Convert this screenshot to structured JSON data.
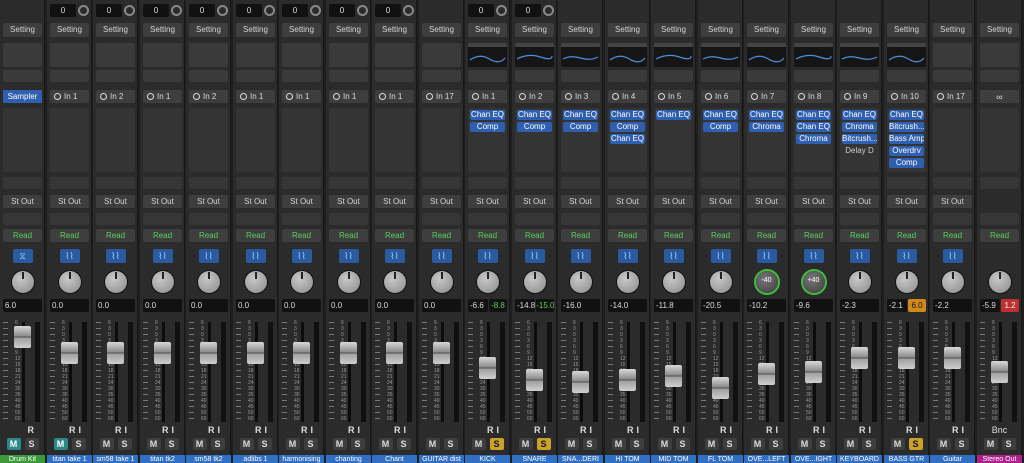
{
  "setting_label": "Setting",
  "read_label": "Read",
  "strips": [
    {
      "gain": "",
      "eq": "empty",
      "input_type": "sampler",
      "input": "Sampler",
      "plugins": [],
      "output": "St Out",
      "pan": "",
      "pan_kind": "io",
      "volume": "6.0",
      "peak": "",
      "peak_style": "none",
      "fader": 0.95,
      "ri": "R",
      "mute_on": true,
      "solo_on": false,
      "name": "Drum Kit",
      "name_color": "#3a9a3a",
      "wave_color": "none"
    },
    {
      "gain": "0",
      "eq": "empty",
      "input_type": "input",
      "input": "In 1",
      "plugins": [],
      "output": "St Out",
      "pan": "",
      "pan_kind": "knob",
      "volume": "0.0",
      "peak": "",
      "peak_style": "none",
      "fader": 0.75,
      "ri": "RI",
      "mute_on": true,
      "solo_on": false,
      "name": "titan take 1",
      "name_color": "#2f6fc4",
      "wave_color": "wave"
    },
    {
      "gain": "0",
      "eq": "empty",
      "input_type": "input",
      "input": "In 2",
      "plugins": [],
      "output": "St Out",
      "pan": "",
      "pan_kind": "knob",
      "volume": "0.0",
      "peak": "",
      "peak_style": "none",
      "fader": 0.75,
      "ri": "RI",
      "mute_on": false,
      "solo_on": false,
      "name": "sm58 take 1",
      "name_color": "#2f6fc4",
      "wave_color": "wave"
    },
    {
      "gain": "0",
      "eq": "empty",
      "input_type": "input",
      "input": "In 1",
      "plugins": [],
      "output": "St Out",
      "pan": "",
      "pan_kind": "knob",
      "volume": "0.0",
      "peak": "",
      "peak_style": "none",
      "fader": 0.75,
      "ri": "RI",
      "mute_on": false,
      "solo_on": false,
      "name": "titan tk2",
      "name_color": "#2f6fc4",
      "wave_color": "wave"
    },
    {
      "gain": "0",
      "eq": "empty",
      "input_type": "input",
      "input": "In 2",
      "plugins": [],
      "output": "St Out",
      "pan": "",
      "pan_kind": "knob",
      "volume": "0.0",
      "peak": "",
      "peak_style": "none",
      "fader": 0.75,
      "ri": "RI",
      "mute_on": false,
      "solo_on": false,
      "name": "sm58 tk2",
      "name_color": "#2f6fc4",
      "wave_color": "wave"
    },
    {
      "gain": "0",
      "eq": "empty",
      "input_type": "input",
      "input": "In 1",
      "plugins": [],
      "output": "St Out",
      "pan": "",
      "pan_kind": "knob",
      "volume": "0.0",
      "peak": "",
      "peak_style": "none",
      "fader": 0.75,
      "ri": "RI",
      "mute_on": false,
      "solo_on": false,
      "name": "adlibs 1",
      "name_color": "#2f6fc4",
      "wave_color": "wave"
    },
    {
      "gain": "0",
      "eq": "empty",
      "input_type": "input",
      "input": "In 1",
      "plugins": [],
      "output": "St Out",
      "pan": "",
      "pan_kind": "knob",
      "volume": "0.0",
      "peak": "",
      "peak_style": "none",
      "fader": 0.75,
      "ri": "RI",
      "mute_on": false,
      "solo_on": false,
      "name": "harmonising",
      "name_color": "#2f6fc4",
      "wave_color": "wave"
    },
    {
      "gain": "0",
      "eq": "empty",
      "input_type": "input",
      "input": "In 1",
      "plugins": [],
      "output": "St Out",
      "pan": "",
      "pan_kind": "knob",
      "volume": "0.0",
      "peak": "",
      "peak_style": "none",
      "fader": 0.75,
      "ri": "RI",
      "mute_on": false,
      "solo_on": false,
      "name": "chanting",
      "name_color": "#2f6fc4",
      "wave_color": "wave"
    },
    {
      "gain": "0",
      "eq": "empty",
      "input_type": "input",
      "input": "In 1",
      "plugins": [],
      "output": "St Out",
      "pan": "",
      "pan_kind": "knob",
      "volume": "0.0",
      "peak": "",
      "peak_style": "none",
      "fader": 0.75,
      "ri": "RI",
      "mute_on": false,
      "solo_on": false,
      "name": "Chant",
      "name_color": "#2f6fc4",
      "wave_color": "wave"
    },
    {
      "gain": "",
      "eq": "empty",
      "input_type": "input",
      "input": "In 17",
      "plugins": [],
      "output": "St Out",
      "pan": "",
      "pan_kind": "knob",
      "volume": "0.0",
      "peak": "",
      "peak_style": "none",
      "fader": 0.75,
      "ri": "",
      "mute_on": false,
      "solo_on": false,
      "name": "GUITAR dist",
      "name_color": "#2f6fc4",
      "wave_color": "wave"
    },
    {
      "gain": "0",
      "eq": "curve",
      "input_type": "input",
      "input": "In 1",
      "plugins": [
        "Chan EQ",
        "Comp"
      ],
      "output": "St Out",
      "pan": "",
      "pan_kind": "knob",
      "volume": "-6.6",
      "peak": "-8.8",
      "peak_style": "green",
      "fader": 0.55,
      "ri": "RI",
      "mute_on": false,
      "solo_on": true,
      "name": "KICK",
      "name_color": "#2f6fc4",
      "wave_color": "wave"
    },
    {
      "gain": "0",
      "eq": "curve",
      "input_type": "input",
      "input": "In 2",
      "plugins": [
        "Chan EQ",
        "Comp"
      ],
      "output": "St Out",
      "pan": "",
      "pan_kind": "knob",
      "volume": "-14.8",
      "peak": "-15.0",
      "peak_style": "green",
      "fader": 0.4,
      "ri": "RI",
      "mute_on": false,
      "solo_on": true,
      "name": "SNARE",
      "name_color": "#2f6fc4",
      "wave_color": "wave"
    },
    {
      "gain": "",
      "eq": "curve",
      "input_type": "input",
      "input": "In 3",
      "plugins": [
        "Chan EQ",
        "Comp"
      ],
      "output": "St Out",
      "pan": "",
      "pan_kind": "knob",
      "volume": "-16.0",
      "peak": "",
      "peak_style": "none",
      "fader": 0.37,
      "ri": "RI",
      "mute_on": false,
      "solo_on": false,
      "name": "SNA...DERI",
      "name_color": "#2f6fc4",
      "wave_color": "wave"
    },
    {
      "gain": "",
      "eq": "curve",
      "input_type": "input",
      "input": "In 4",
      "plugins": [
        "Chan EQ",
        "Comp",
        "Chan EQ"
      ],
      "output": "St Out",
      "pan": "",
      "pan_kind": "knob",
      "volume": "-14.0",
      "peak": "",
      "peak_style": "none",
      "fader": 0.4,
      "ri": "RI",
      "mute_on": false,
      "solo_on": false,
      "name": "HI TOM",
      "name_color": "#2f6fc4",
      "wave_color": "wave"
    },
    {
      "gain": "",
      "eq": "curve",
      "input_type": "input",
      "input": "In 5",
      "plugins": [
        "Chan EQ"
      ],
      "output": "St Out",
      "pan": "",
      "pan_kind": "knob",
      "volume": "-11.8",
      "peak": "",
      "peak_style": "none",
      "fader": 0.45,
      "ri": "RI",
      "mute_on": false,
      "solo_on": false,
      "name": "MID TOM",
      "name_color": "#2f6fc4",
      "wave_color": "wave"
    },
    {
      "gain": "",
      "eq": "curve",
      "input_type": "input",
      "input": "In 6",
      "plugins": [
        "Chan EQ",
        "Comp"
      ],
      "output": "St Out",
      "pan": "",
      "pan_kind": "knob",
      "volume": "-20.5",
      "peak": "",
      "peak_style": "none",
      "fader": 0.3,
      "ri": "RI",
      "mute_on": false,
      "solo_on": false,
      "name": "FL TOM",
      "name_color": "#2f6fc4",
      "wave_color": "wave"
    },
    {
      "gain": "",
      "eq": "curve",
      "input_type": "input",
      "input": "In 7",
      "plugins": [
        "Chan EQ",
        "Chroma"
      ],
      "output": "St Out",
      "pan": "-40",
      "pan_kind": "green",
      "volume": "-10.2",
      "peak": "",
      "peak_style": "none",
      "fader": 0.48,
      "ri": "RI",
      "mute_on": false,
      "solo_on": false,
      "name": "OVE...LEFT",
      "name_color": "#2f6fc4",
      "wave_color": "wave"
    },
    {
      "gain": "",
      "eq": "curve",
      "input_type": "input",
      "input": "In 8",
      "plugins": [
        "Chan EQ",
        "Chan EQ",
        "Chroma"
      ],
      "output": "St Out",
      "pan": "+40",
      "pan_kind": "green",
      "volume": "-9.6",
      "peak": "",
      "peak_style": "none",
      "fader": 0.5,
      "ri": "RI",
      "mute_on": false,
      "solo_on": false,
      "name": "OVE...IGHT",
      "name_color": "#2f6fc4",
      "wave_color": "wave"
    },
    {
      "gain": "",
      "eq": "curve",
      "input_type": "input",
      "input": "In 9",
      "plugins": [
        "Chan EQ",
        "Chroma",
        "Bitcrush...",
        "Delay D"
      ],
      "output": "St Out",
      "pan": "",
      "pan_kind": "knob",
      "volume": "-2.3",
      "peak": "",
      "peak_style": "none",
      "fader": 0.68,
      "ri": "RI",
      "mute_on": false,
      "solo_on": false,
      "name": "KEYBOARD",
      "name_color": "#2f6fc4",
      "wave_color": "wave"
    },
    {
      "gain": "",
      "eq": "curve",
      "input_type": "input",
      "input": "In 10",
      "plugins": [
        "Chan EQ",
        "Bitcrush...",
        "Bass Amp",
        "Overdrv",
        "Comp"
      ],
      "output": "St Out",
      "pan": "",
      "pan_kind": "knob",
      "volume": "-2.1",
      "peak": "6.0",
      "peak_style": "orange",
      "fader": 0.68,
      "ri": "RI",
      "mute_on": false,
      "solo_on": true,
      "name": "BASS GTR",
      "name_color": "#2f6fc4",
      "wave_color": "wave"
    },
    {
      "gain": "",
      "eq": "empty",
      "input_type": "input",
      "input": "In 17",
      "plugins": [],
      "output": "St Out",
      "pan": "",
      "pan_kind": "knob",
      "volume": "-2.2",
      "peak": "",
      "peak_style": "none",
      "fader": 0.68,
      "ri": "RI",
      "mute_on": false,
      "solo_on": false,
      "name": "Guitar",
      "name_color": "#2f6fc4",
      "wave_color": "wave"
    },
    {
      "gain": "",
      "eq": "empty",
      "input_type": "link",
      "input": "",
      "plugins": [],
      "output": "",
      "pan": "",
      "pan_kind": "knob",
      "volume": "-5.9",
      "peak": "1.2",
      "peak_style": "red",
      "fader": 0.5,
      "ri": "Bnc",
      "mute_on": false,
      "solo_on": false,
      "name": "Stereo Out",
      "name_color": "#b0208a",
      "wave_color": "none"
    }
  ],
  "scale_labels": [
    "6",
    "3",
    "0",
    "3",
    "6",
    "9",
    "12",
    "15",
    "18",
    "21",
    "24",
    "30",
    "35",
    "40",
    "45",
    "50",
    "60"
  ]
}
